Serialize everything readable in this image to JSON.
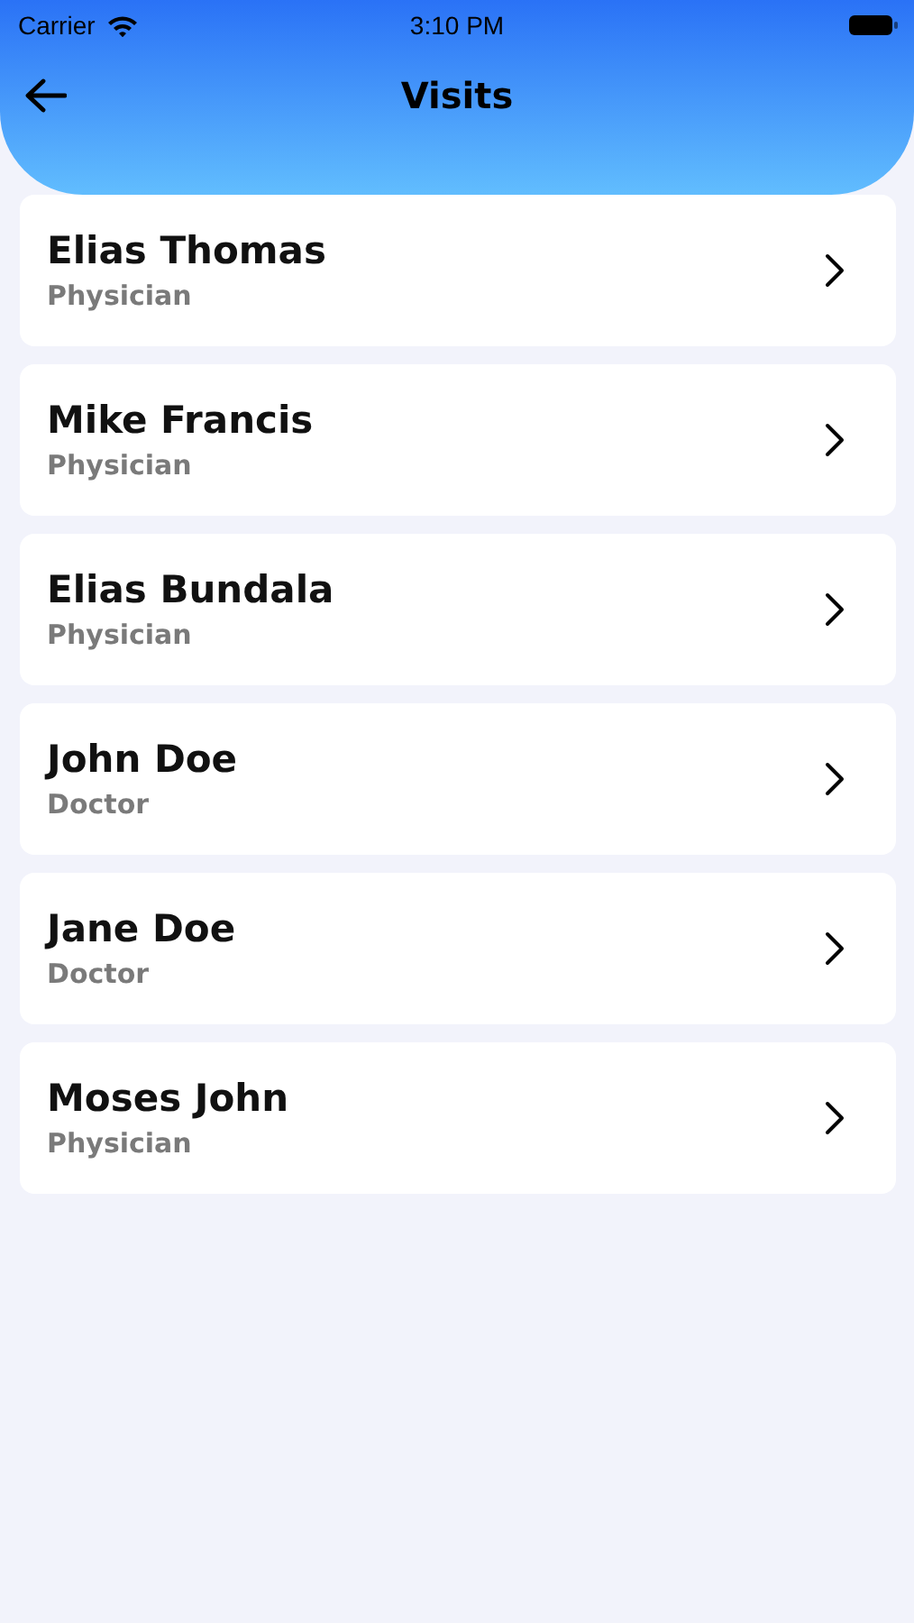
{
  "status_bar": {
    "carrier": "Carrier",
    "time": "3:10 PM"
  },
  "header": {
    "title": "Visits"
  },
  "visits": [
    {
      "name": "Elias Thomas",
      "role": "Physician"
    },
    {
      "name": "Mike Francis",
      "role": "Physician"
    },
    {
      "name": "Elias Bundala",
      "role": "Physician"
    },
    {
      "name": "John Doe",
      "role": "Doctor"
    },
    {
      "name": "Jane Doe",
      "role": "Doctor"
    },
    {
      "name": "Moses John",
      "role": "Physician"
    }
  ]
}
